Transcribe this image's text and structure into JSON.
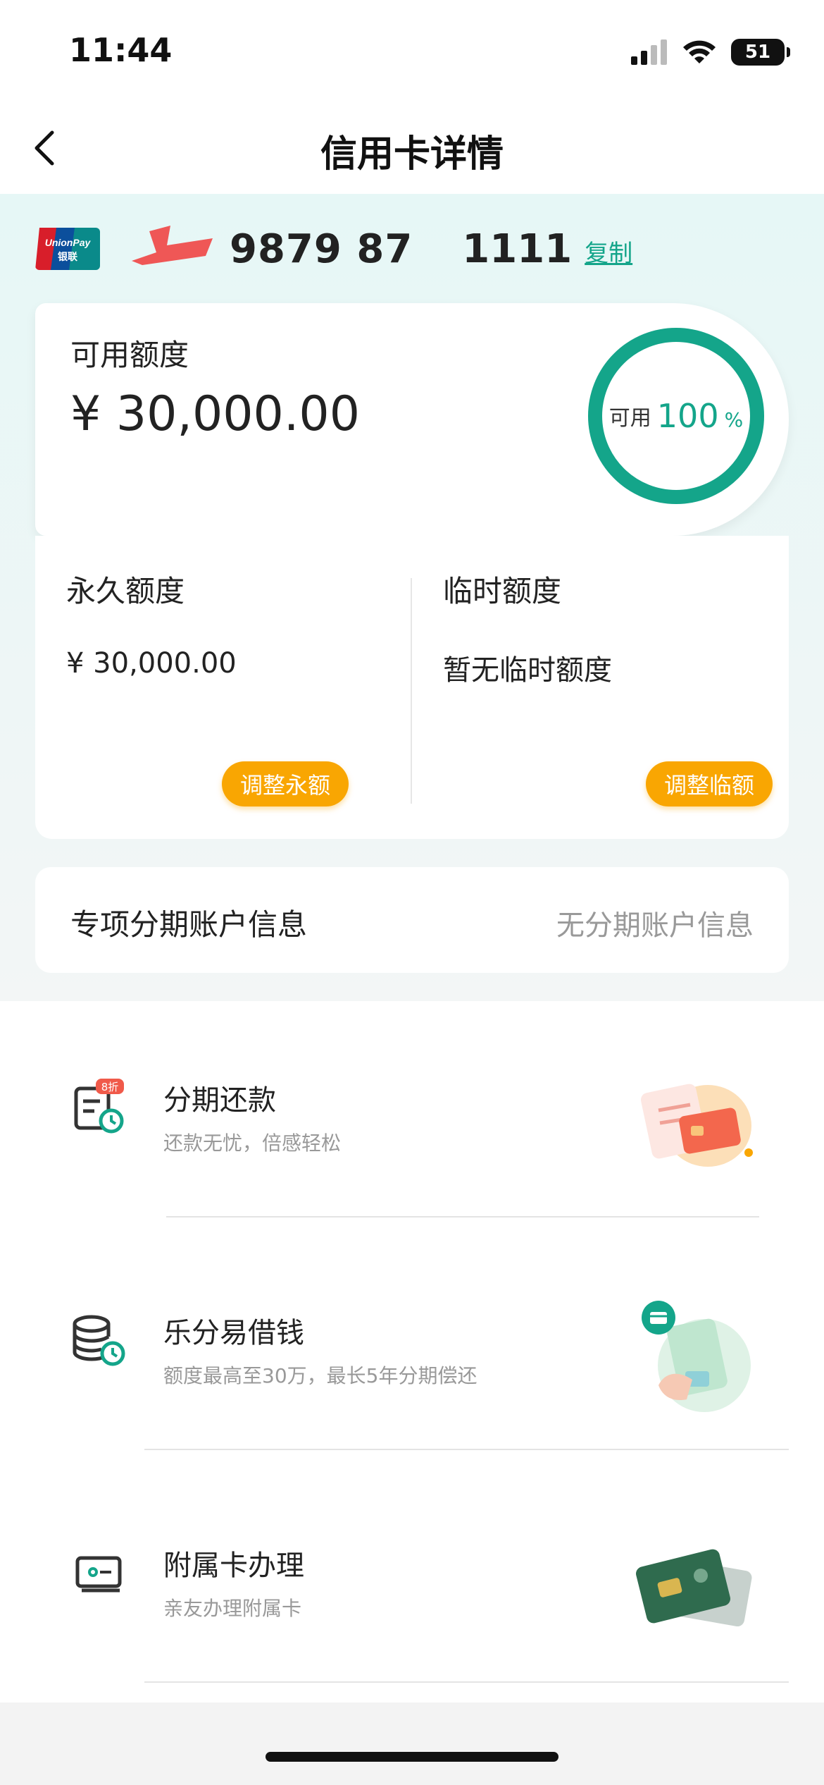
{
  "status_bar": {
    "time": "11:44",
    "battery": "51"
  },
  "nav": {
    "title": "信用卡详情"
  },
  "card": {
    "number_part1": "9879 87",
    "number_part2": "1111",
    "copy_label": "复制"
  },
  "available": {
    "label": "可用额度",
    "amount": "¥ 30,000.00",
    "ring_label": "可用",
    "ring_percent": "100",
    "ring_unit": "%",
    "ring_fraction": 1.0
  },
  "quota": {
    "permanent": {
      "title": "永久额度",
      "value": "¥ 30,000.00",
      "button": "调整永额"
    },
    "temporary": {
      "title": "临时额度",
      "value": "暂无临时额度",
      "button": "调整临额"
    }
  },
  "installment_account": {
    "label": "专项分期账户信息",
    "value": "无分期账户信息"
  },
  "services": [
    {
      "title": "分期还款",
      "subtitle": "还款无忧，倍感轻松",
      "badge": "8折",
      "icon": "installment-bill-icon"
    },
    {
      "title": "乐分易借钱",
      "subtitle": "额度最高至30万，最长5年分期偿还",
      "icon": "coin-stack-clock-icon"
    },
    {
      "title": "附属卡办理",
      "subtitle": "亲友办理附属卡",
      "icon": "card-icon"
    }
  ],
  "colors": {
    "accent": "#14a58a",
    "button": "#f9a602",
    "text": "#222222",
    "muted": "#999999"
  }
}
